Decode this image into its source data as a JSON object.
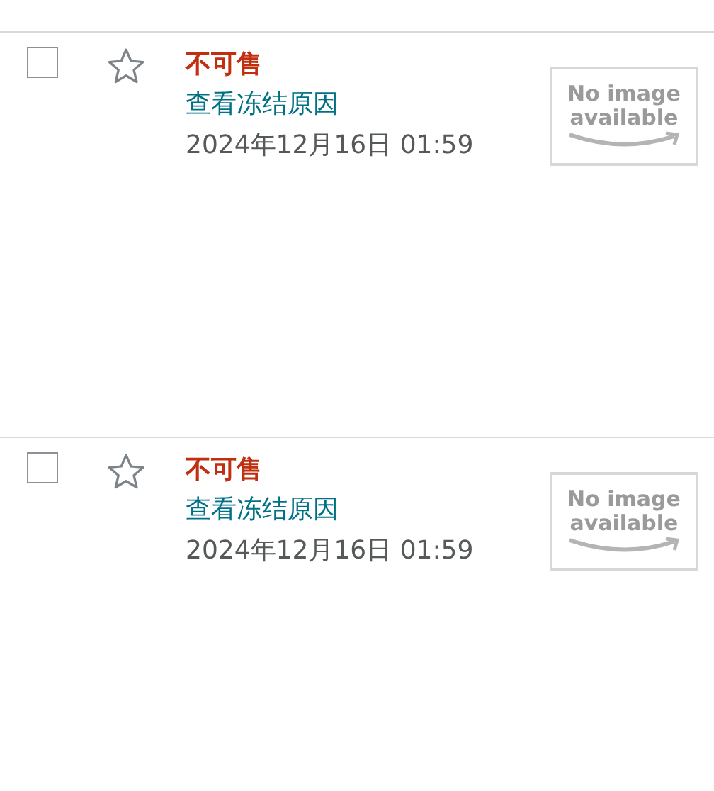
{
  "items": [
    {
      "checked": false,
      "starred": false,
      "status": "不可售",
      "link": "查看冻结原因",
      "date": "2024年12月16日 01:59",
      "image_text": "No image available"
    },
    {
      "checked": false,
      "starred": false,
      "status": "不可售",
      "link": "查看冻结原因",
      "date": "2024年12月16日 01:59",
      "image_text": "No image available"
    }
  ]
}
